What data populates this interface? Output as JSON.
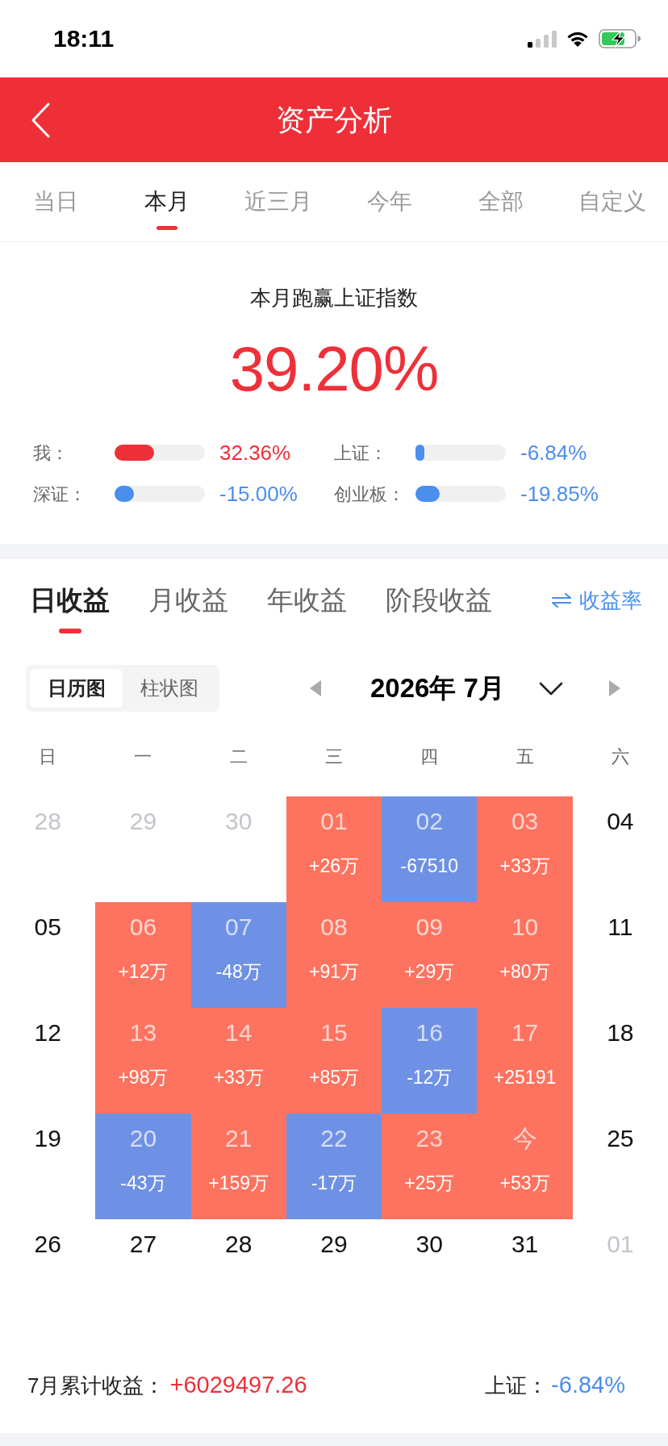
{
  "status_bar": {
    "time": "18:11"
  },
  "header": {
    "title": "资产分析"
  },
  "period_tabs": [
    {
      "label": "当日",
      "selected": false
    },
    {
      "label": "本月",
      "selected": true
    },
    {
      "label": "近三月",
      "selected": false
    },
    {
      "label": "今年",
      "selected": false
    },
    {
      "label": "全部",
      "selected": false
    },
    {
      "label": "自定义",
      "selected": false
    }
  ],
  "summary": {
    "title": "本月跑赢上证指数",
    "value": "39.20%",
    "comparisons": [
      {
        "label": "我：",
        "value": "32.36%",
        "level": 0.44,
        "color": "#ee3039"
      },
      {
        "label": "上证：",
        "value": "-6.84%",
        "level": 0.1,
        "color": "#4a8eee"
      },
      {
        "label": "深证：",
        "value": "-15.00%",
        "level": 0.21,
        "color": "#4a8eee"
      },
      {
        "label": "创业板：",
        "value": "-19.85%",
        "level": 0.27,
        "color": "#4a8eee"
      }
    ]
  },
  "earnings_tabs": [
    {
      "label": "日收益",
      "selected": true
    },
    {
      "label": "月收益",
      "selected": false
    },
    {
      "label": "年收益",
      "selected": false
    },
    {
      "label": "阶段收益",
      "selected": false
    }
  ],
  "rate_toggle": {
    "label": "收益率"
  },
  "view_switch": [
    {
      "label": "日历图",
      "selected": true
    },
    {
      "label": "柱状图",
      "selected": false
    }
  ],
  "month_picker": {
    "label": "2026年 7月"
  },
  "calendar": {
    "weekdays": [
      "日",
      "一",
      "二",
      "三",
      "四",
      "五",
      "六"
    ],
    "weeks": [
      [
        {
          "day": "28",
          "other_month": true
        },
        {
          "day": "29",
          "other_month": true
        },
        {
          "day": "30",
          "other_month": true
        },
        {
          "day": "01",
          "other_month": false,
          "amount": "+26万",
          "color": "#fd735f"
        },
        {
          "day": "02",
          "other_month": false,
          "amount": "-67510",
          "color": "#6f91e5"
        },
        {
          "day": "03",
          "other_month": false,
          "amount": "+33万",
          "color": "#fd735f"
        },
        {
          "day": "04",
          "other_month": false
        }
      ],
      [
        {
          "day": "05",
          "other_month": false
        },
        {
          "day": "06",
          "other_month": false,
          "amount": "+12万",
          "color": "#fd735f"
        },
        {
          "day": "07",
          "other_month": false,
          "amount": "-48万",
          "color": "#6f91e5"
        },
        {
          "day": "08",
          "other_month": false,
          "amount": "+91万",
          "color": "#fd735f"
        },
        {
          "day": "09",
          "other_month": false,
          "amount": "+29万",
          "color": "#fd735f"
        },
        {
          "day": "10",
          "other_month": false,
          "amount": "+80万",
          "color": "#fd735f"
        },
        {
          "day": "11",
          "other_month": false
        }
      ],
      [
        {
          "day": "12",
          "other_month": false
        },
        {
          "day": "13",
          "other_month": false,
          "amount": "+98万",
          "color": "#fd735f"
        },
        {
          "day": "14",
          "other_month": false,
          "amount": "+33万",
          "color": "#fd735f"
        },
        {
          "day": "15",
          "other_month": false,
          "amount": "+85万",
          "color": "#fd735f"
        },
        {
          "day": "16",
          "other_month": false,
          "amount": "-12万",
          "color": "#6f91e5"
        },
        {
          "day": "17",
          "other_month": false,
          "amount": "+25191",
          "color": "#fd735f"
        },
        {
          "day": "18",
          "other_month": false
        }
      ],
      [
        {
          "day": "19",
          "other_month": false
        },
        {
          "day": "20",
          "other_month": false,
          "amount": "-43万",
          "color": "#6f91e5"
        },
        {
          "day": "21",
          "other_month": false,
          "amount": "+159万",
          "color": "#fd735f"
        },
        {
          "day": "22",
          "other_month": false,
          "amount": "-17万",
          "color": "#6f91e5"
        },
        {
          "day": "23",
          "other_month": false,
          "amount": "+25万",
          "color": "#fd735f"
        },
        {
          "day": "今",
          "other_month": false,
          "amount": "+53万",
          "color": "#fd735f"
        },
        {
          "day": "25",
          "other_month": false
        }
      ],
      [
        {
          "day": "26",
          "other_month": false
        },
        {
          "day": "27",
          "other_month": false
        },
        {
          "day": "28",
          "other_month": false
        },
        {
          "day": "29",
          "other_month": false
        },
        {
          "day": "30",
          "other_month": false
        },
        {
          "day": "31",
          "other_month": false
        },
        {
          "day": "01",
          "other_month": true
        }
      ]
    ]
  },
  "footer": {
    "label": "7月累计收益：",
    "value": "+6029497.26",
    "index_label": "上证：",
    "index_value": "-6.84%"
  }
}
